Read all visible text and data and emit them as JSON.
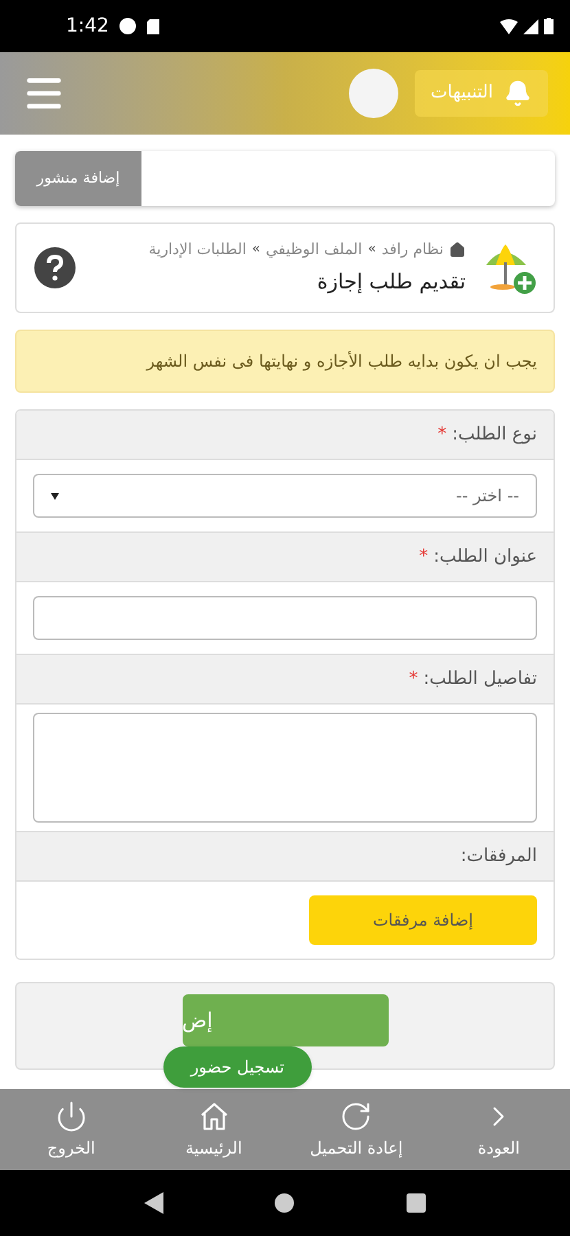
{
  "status_bar": {
    "time": "1:42"
  },
  "header": {
    "notifications_label": "التنبيهات"
  },
  "add_post_button": "إضافة منشور",
  "page_card": {
    "breadcrumb": [
      "نظام رافد",
      "الملف الوظيفي",
      "الطلبات الإدارية"
    ],
    "breadcrumb_separator": "»",
    "title": "تقديم طلب إجازة"
  },
  "alert": "يجب ان يكون بدايه طلب الأجازه و نهايتها فى نفس الشهر",
  "form": {
    "required_mark": "*",
    "fields": [
      {
        "kind": "select",
        "label": "نوع الطلب:",
        "required": true,
        "value": "-- اختر --"
      },
      {
        "kind": "text",
        "label": "عنوان الطلب:",
        "required": true
      },
      {
        "kind": "textarea",
        "label": "تفاصيل الطلب:",
        "required": true
      },
      {
        "kind": "attachments",
        "label": "المرفقات:",
        "required": false,
        "button": "إضافة مرفقات"
      }
    ]
  },
  "submit_button": "إض",
  "floating_button": "تسجيل حضور",
  "bottom_nav": [
    {
      "kind": "back",
      "label": "العودة"
    },
    {
      "kind": "reload",
      "label": "إعادة التحميل"
    },
    {
      "kind": "home",
      "label": "الرئيسية"
    },
    {
      "kind": "logout",
      "label": "الخروج"
    }
  ]
}
